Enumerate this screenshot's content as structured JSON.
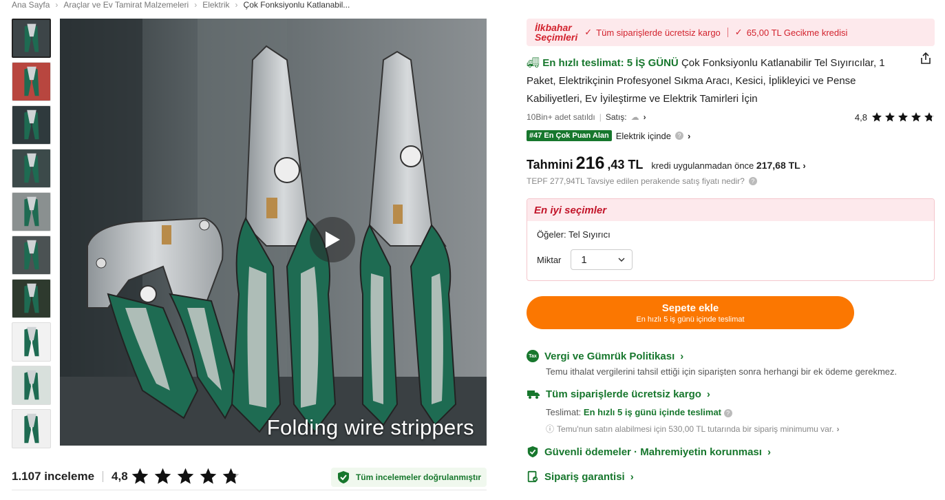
{
  "breadcrumb": {
    "items": [
      "Ana Sayfa",
      "Araçlar ve Ev Tamirat Malzemeleri",
      "Elektrik",
      "Çok Fonksiyonlu Katlanabil..."
    ]
  },
  "gallery": {
    "caption": "Folding wire strippers",
    "thumbnail_count": 10
  },
  "reviews": {
    "count_label": "1.107 inceleme",
    "rating": "4,8",
    "stars": 4.8,
    "verified_label": "Tüm incelemeler doğrulanmıştır"
  },
  "promo": {
    "logo_line1": "İlkbahar",
    "logo_line2": "Seçimleri",
    "item1": "Tüm siparişlerde ücretsiz kargo",
    "item2": "65,00 TL Gecikme kredisi"
  },
  "product": {
    "fast_label": "En hızlı teslimat: 5 İŞ GÜNÜ",
    "title": "Çok Fonksiyonlu Katlanabilir Tel Sıyırıcılar, 1 Paket, Elektrikçinin Profesyonel Sıkma Aracı, Kesici, İplikleyici ve Pense Kabiliyetleri, Ev İyileştirme ve Elektrik Tamirleri İçin",
    "sold": "10Bin+ adet satıldı",
    "seller_label": "Satış:",
    "rating": "4,8",
    "stars": 4.8,
    "rank_badge": "#47 En Çok Puan Alan",
    "rank_category": "Elektrik içinde"
  },
  "price": {
    "label": "Tahmini",
    "integer": "216",
    "decimal": ",43 TL",
    "before_label": "kredi uygulanmadan önce",
    "before_value": "217,68 TL",
    "rrp": "TEPF 277,94TL Tavsiye edilen perakende satış fiyatı nedir?"
  },
  "best": {
    "heading": "En iyi seçimler",
    "item_label": "Öğeler: Tel Sıyırıcı",
    "qty_label": "Miktar",
    "qty_value": "1"
  },
  "cart": {
    "label": "Sepete ekle",
    "sub": "En hızlı 5 iş günü içinde teslimat"
  },
  "info": {
    "tax_badge": "Tax",
    "tax_title": "Vergi ve Gümrük Politikası",
    "tax_text": "Temu ithalat vergilerini tahsil ettiği için siparişten sonra herhangi bir ek ödeme gerekmez.",
    "ship_title": "Tüm siparişlerde ücretsiz kargo",
    "delivery_label": "Teslimat:",
    "delivery_value": "En hızlı 5 iş günü içinde teslimat",
    "min_note": "Temu'nun satın alabilmesi için 530,00 TL tutarında bir sipariş minimumu var.",
    "secure_title": "Güvenli ödemeler · Mahremiyetin korunması",
    "guarantee_title": "Sipariş garantisi"
  },
  "colors": {
    "green": "#17772d",
    "orange": "#fb7701",
    "red": "#d2222d"
  }
}
